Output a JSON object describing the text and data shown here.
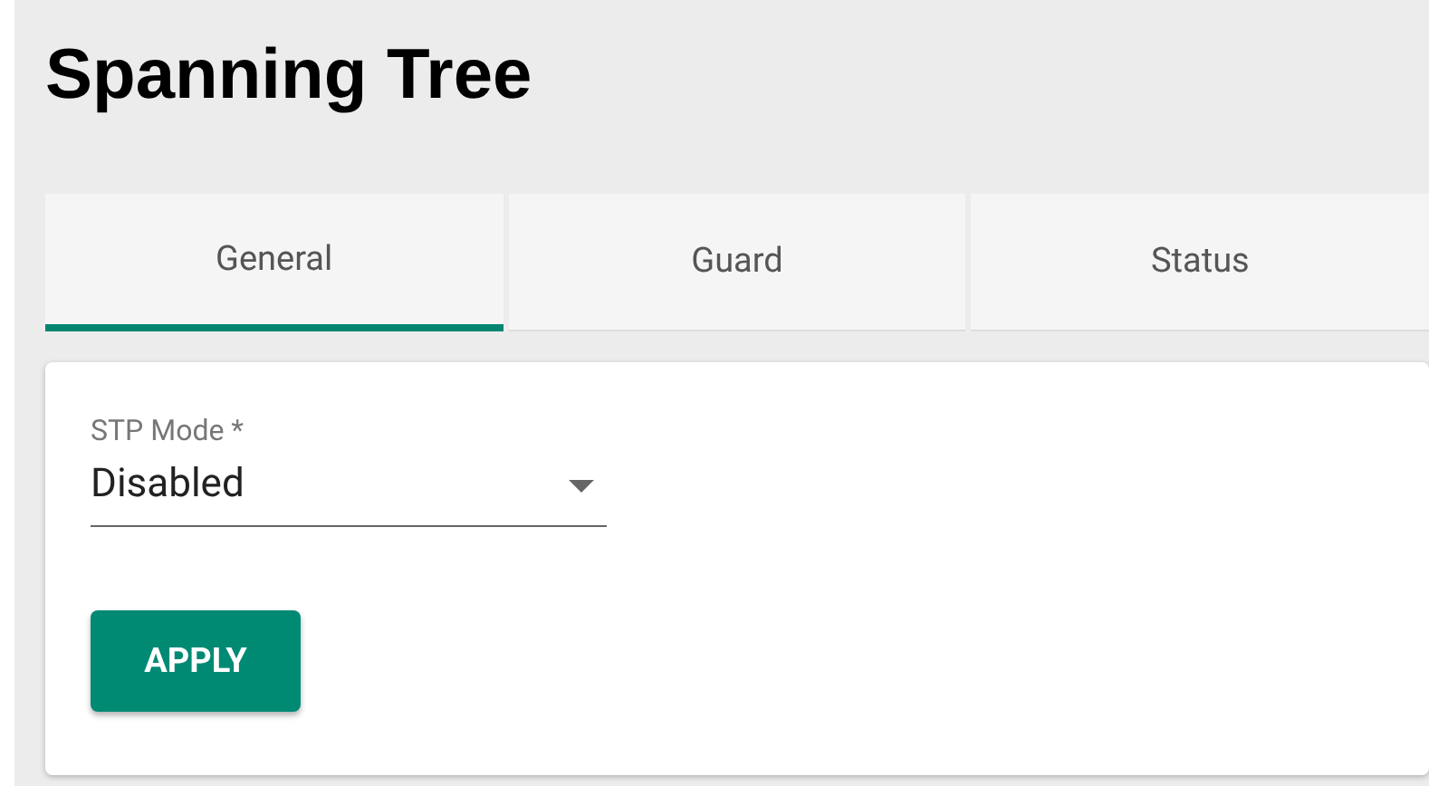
{
  "page": {
    "title": "Spanning Tree"
  },
  "tabs": [
    {
      "label": "General",
      "selected": true
    },
    {
      "label": "Guard",
      "selected": false
    },
    {
      "label": "Status",
      "selected": false
    }
  ],
  "form": {
    "fields": [
      {
        "label": "STP Mode *",
        "value": "Disabled"
      }
    ],
    "buttons": [
      "APPLY"
    ]
  }
}
